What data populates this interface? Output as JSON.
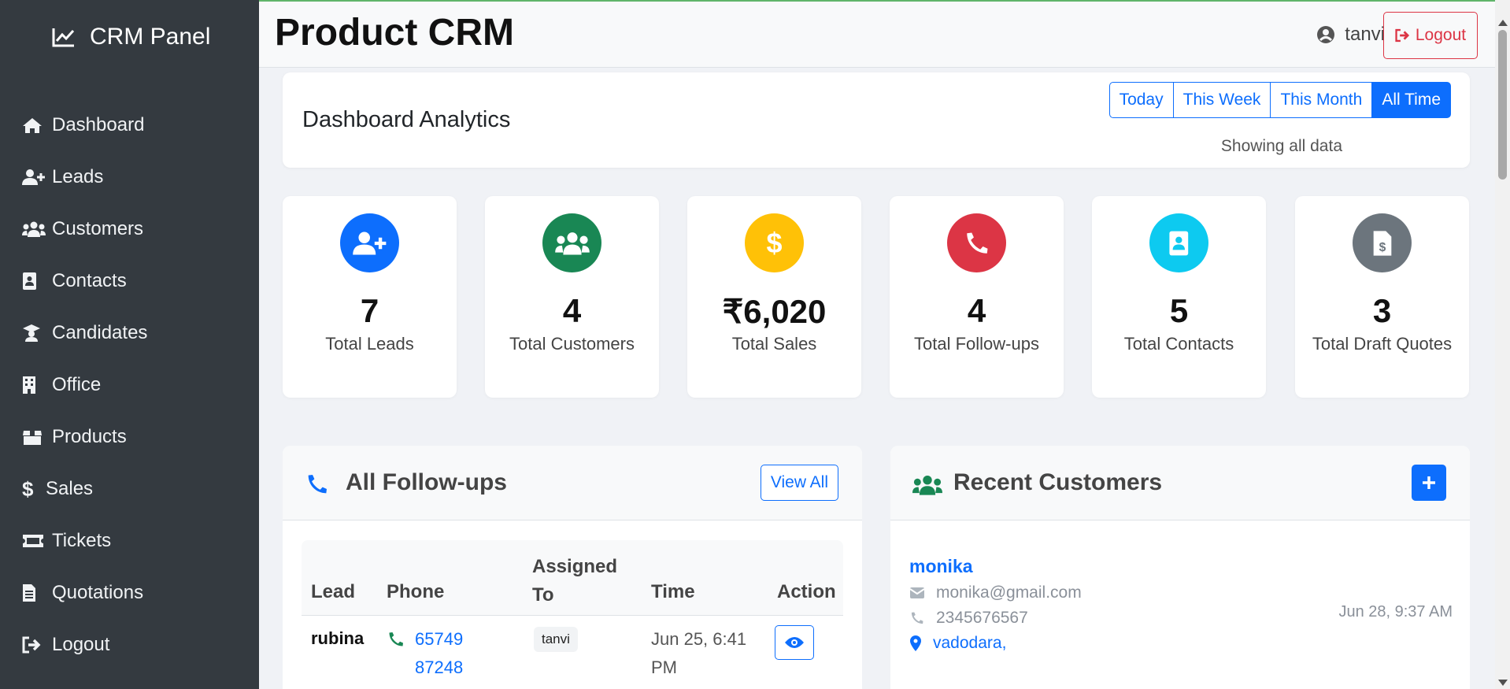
{
  "sidebar": {
    "brand": "CRM Panel",
    "items": [
      {
        "label": "Dashboard",
        "icon": "home-icon"
      },
      {
        "label": "Leads",
        "icon": "user-plus-icon"
      },
      {
        "label": "Customers",
        "icon": "users-icon"
      },
      {
        "label": "Contacts",
        "icon": "address-book-icon"
      },
      {
        "label": "Candidates",
        "icon": "graduate-icon"
      },
      {
        "label": "Office",
        "icon": "building-icon"
      },
      {
        "label": "Products",
        "icon": "box-icon"
      },
      {
        "label": "Sales",
        "icon": "dollar-icon"
      },
      {
        "label": "Tickets",
        "icon": "ticket-icon"
      },
      {
        "label": "Quotations",
        "icon": "file-invoice-icon"
      },
      {
        "label": "Logout",
        "icon": "sign-out-icon"
      }
    ]
  },
  "header": {
    "title": "Product CRM",
    "username": "tanvi",
    "logout_label": "Logout"
  },
  "analytics": {
    "title": "Dashboard Analytics",
    "ranges": [
      "Today",
      "This Week",
      "This Month",
      "All Time"
    ],
    "active_range": "All Time",
    "status": "Showing all data"
  },
  "stats": [
    {
      "value": "7",
      "label": "Total Leads",
      "color": "#0d6efd",
      "icon": "user-plus-icon"
    },
    {
      "value": "4",
      "label": "Total Customers",
      "color": "#198754",
      "icon": "users-icon"
    },
    {
      "value": "₹6,020",
      "label": "Total Sales",
      "color": "#ffc107",
      "icon": "dollar-icon"
    },
    {
      "value": "4",
      "label": "Total Follow-ups",
      "color": "#dc3545",
      "icon": "phone-icon"
    },
    {
      "value": "5",
      "label": "Total Contacts",
      "color": "#0dcaf0",
      "icon": "address-book-icon"
    },
    {
      "value": "3",
      "label": "Total Draft Quotes",
      "color": "#6c757d",
      "icon": "file-invoice-icon"
    }
  ],
  "followups": {
    "title": "All Follow-ups",
    "view_all": "View All",
    "columns": [
      "Lead",
      "Phone",
      "Assigned To",
      "Time",
      "Action"
    ],
    "rows": [
      {
        "lead": "rubina",
        "phone": "65749 87248",
        "assigned": "tanvi",
        "time": "Jun 25, 6:41 PM"
      }
    ]
  },
  "customers": {
    "title": "Recent Customers",
    "items": [
      {
        "name": "monika",
        "email": "monika@gmail.com",
        "phone": "2345676567",
        "location": "vadodara,",
        "date": "Jun 28, 9:37 AM"
      }
    ]
  }
}
